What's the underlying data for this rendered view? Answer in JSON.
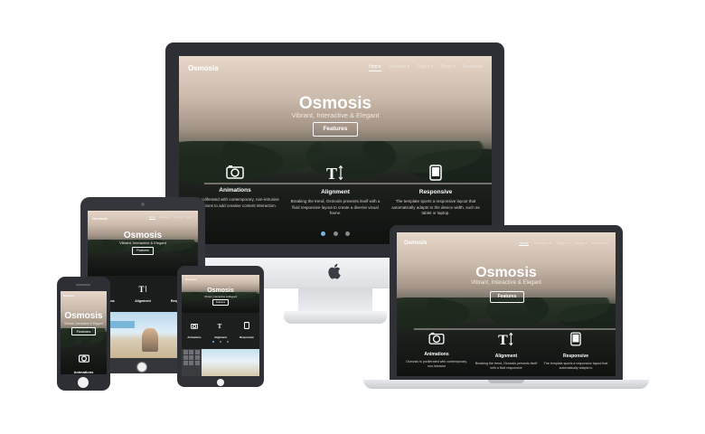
{
  "site": {
    "logo": "Osmosis",
    "title": "Osmosis",
    "tagline": "Vibrant, Interactive & Elegant",
    "tagline_short": "Vibrant, Interactive & Elegant",
    "cta_label": "Features",
    "nav": [
      "Home",
      "Features ▾",
      "Pages ▾",
      "Blogs ▾",
      "Download"
    ],
    "features": [
      {
        "icon": "camera-icon",
        "title": "Animations",
        "text": "is is proliferated with contemporary, non-intrusive animations to add creative content interaction."
      },
      {
        "icon": "text-size-icon",
        "title": "Alignment",
        "text": "Breaking the trend, Osmosis presents itself with a fluid responsive layout to create a diverse visual frame."
      },
      {
        "icon": "tablet-icon",
        "title": "Responsive",
        "text": "The template sports a responsive layout that automatically adapts to the device width, such as tablet or laptop."
      }
    ],
    "laptop_features": [
      {
        "title": "Animations",
        "text": "Osmosis is proliferated with contemporary, non-intrusive"
      },
      {
        "title": "Alignment",
        "text": "Breaking the trend, Osmosis presents itself with a fluid responsive"
      },
      {
        "title": "Responsive",
        "text": "The template sports a responsive layout that automatically adapts to"
      }
    ],
    "slider": {
      "count": 3,
      "active": 1
    }
  },
  "colors": {
    "device_dark": "#2d2f34",
    "device_silver": "#e6e8eb",
    "accent_dot": "#6fb8e8"
  }
}
